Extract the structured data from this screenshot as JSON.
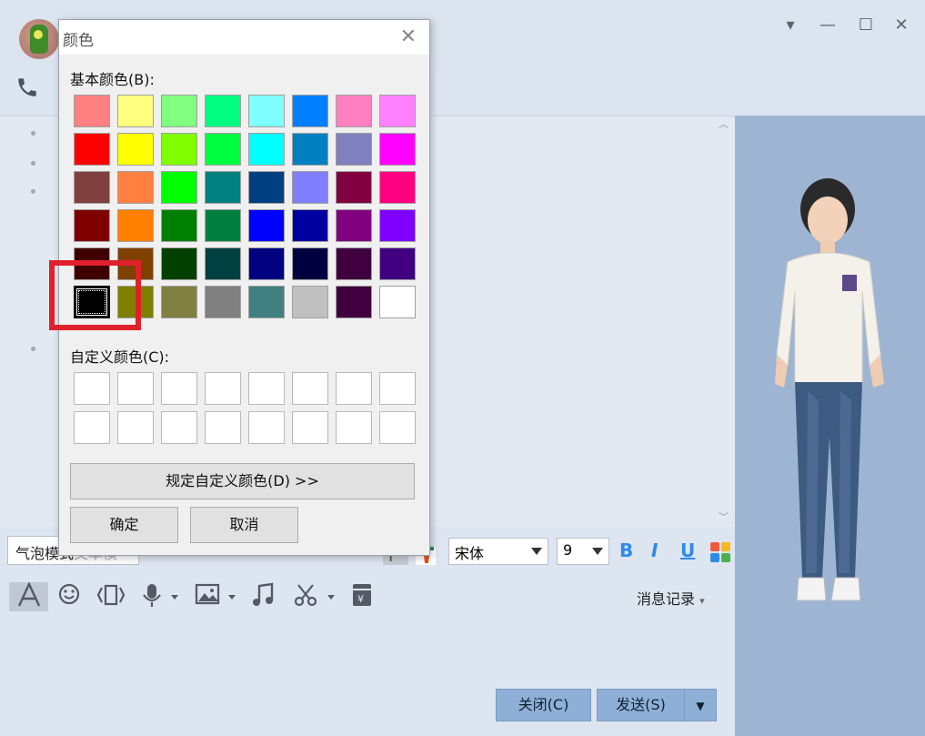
{
  "window": {
    "controls": [
      "▾",
      "—",
      "☐",
      "✕"
    ]
  },
  "toolbar": {
    "bubble_mode": "气泡模式",
    "text_mode_hint": "文本模式",
    "font_name": "宋体",
    "font_size": "9",
    "bold": "B",
    "italic": "I",
    "underline": "U",
    "history": "消息记录"
  },
  "actions": {
    "close": "关闭(C)",
    "send": "发送(S)"
  },
  "dialog": {
    "title": "颜色",
    "basic_label": "基本颜色(B):",
    "custom_label": "自定义颜色(C):",
    "define_custom": "规定自定义颜色(D) >>",
    "ok": "确定",
    "cancel": "取消",
    "basic_colors": [
      [
        "#FF8080",
        "#FFFF80",
        "#80FF80",
        "#00FF80",
        "#80FFFF",
        "#0080FF",
        "#FF80C0",
        "#FF80FF"
      ],
      [
        "#FF0000",
        "#FFFF00",
        "#80FF00",
        "#00FF40",
        "#00FFFF",
        "#0080C0",
        "#8080C0",
        "#FF00FF"
      ],
      [
        "#804040",
        "#FF8040",
        "#00FF00",
        "#008080",
        "#004080",
        "#8080FF",
        "#800040",
        "#FF0080"
      ],
      [
        "#800000",
        "#FF8000",
        "#008000",
        "#008040",
        "#0000FF",
        "#0000A0",
        "#800080",
        "#8000FF"
      ],
      [
        "#400000",
        "#804000",
        "#004000",
        "#004040",
        "#000080",
        "#000040",
        "#400040",
        "#400080"
      ],
      [
        "#000000",
        "#808000",
        "#808040",
        "#808080",
        "#408080",
        "#C0C0C0",
        "#400040",
        "#FFFFFF"
      ]
    ],
    "selected_color": "#000000",
    "custom_colors_count": 16
  },
  "accent": {
    "highlight": "#E0202A",
    "button_blue": "#8FB0D6",
    "format_blue": "#2E8BE6"
  }
}
